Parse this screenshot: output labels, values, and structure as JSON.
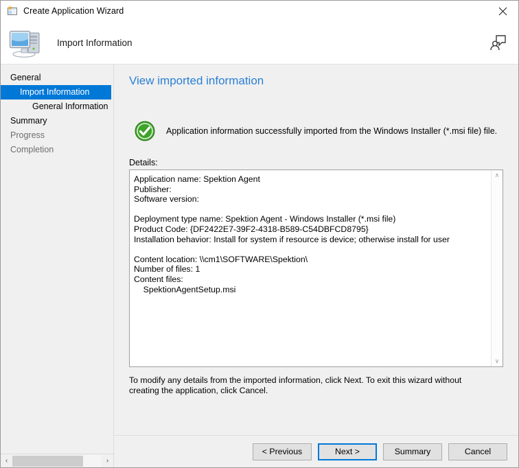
{
  "window": {
    "title": "Create Application Wizard",
    "title_icon": "wizard-window-icon",
    "close_icon": "close-icon"
  },
  "header": {
    "title": "Import Information",
    "icon": "computer-icon",
    "feedback_icon": "feedback-person-icon"
  },
  "sidebar": {
    "items": [
      {
        "label": "General",
        "indent": 0,
        "state": "normal"
      },
      {
        "label": "Import Information",
        "indent": 1,
        "state": "selected"
      },
      {
        "label": "General Information",
        "indent": 2,
        "state": "normal"
      },
      {
        "label": "Summary",
        "indent": 0,
        "state": "normal"
      },
      {
        "label": "Progress",
        "indent": 0,
        "state": "disabled"
      },
      {
        "label": "Completion",
        "indent": 0,
        "state": "disabled"
      }
    ],
    "hscroll": {
      "left_arrow": "‹",
      "right_arrow": "›"
    }
  },
  "main": {
    "page_title": "View imported information",
    "status": {
      "icon": "success-check-icon",
      "message": "Application information successfully imported from the Windows Installer (*.msi file) file."
    },
    "details_label": "Details:",
    "details_text": "Application name: Spektion Agent\nPublisher:\nSoftware version:\n\nDeployment type name: Spektion Agent - Windows Installer (*.msi file)\nProduct Code: {DF2422E7-39F2-4318-B589-C54DBFCD8795}\nInstallation behavior: Install for system if resource is device; otherwise install for user\n\nContent location: \\\\cm1\\SOFTWARE\\Spektion\\\nNumber of files: 1\nContent files:\n    SpektionAgentSetup.msi",
    "details_scroll": {
      "up_arrow": "∧",
      "down_arrow": "∨"
    },
    "footnote": "To modify any details from the imported information, click Next. To exit this wizard without creating the application, click Cancel."
  },
  "footer": {
    "buttons": [
      {
        "label": "< Previous",
        "focused": false
      },
      {
        "label": "Next >",
        "focused": true
      },
      {
        "label": "Summary",
        "focused": false
      },
      {
        "label": "Cancel",
        "focused": false
      }
    ]
  },
  "colors": {
    "accent": "#0078d7",
    "title_link": "#2a7fd4",
    "panel_bg": "#f0f0f0",
    "success_green": "#3fa22a"
  }
}
